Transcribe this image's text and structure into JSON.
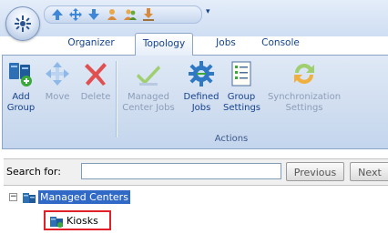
{
  "quick_access": {
    "buttons": [
      "up-arrow-icon",
      "move-icon",
      "down-arrow-icon",
      "new-user-icon",
      "users-icon",
      "download-icon"
    ],
    "more": "▾"
  },
  "tabs": [
    {
      "label": "Organizer",
      "active": false
    },
    {
      "label": "Topology",
      "active": true
    },
    {
      "label": "Jobs",
      "active": false
    },
    {
      "label": "Console",
      "active": false
    }
  ],
  "ribbon": {
    "add_group": "Add\nGroup",
    "move": "Move",
    "delete": "Delete",
    "managed_center_jobs": "Managed\nCenter Jobs",
    "defined_jobs": "Defined\nJobs",
    "group_settings": "Group\nSettings",
    "synchronization_settings": "Synchronization\nSettings",
    "group_label": "Actions"
  },
  "search": {
    "label": "Search for:",
    "value": "",
    "previous": "Previous",
    "next": "Next"
  },
  "tree": {
    "expander": "⊟",
    "root": "Managed Centers",
    "child": "Kiosks"
  },
  "colors": {
    "accent": "#15428b",
    "selection": "#3169c6",
    "highlight": "#e1202a"
  }
}
